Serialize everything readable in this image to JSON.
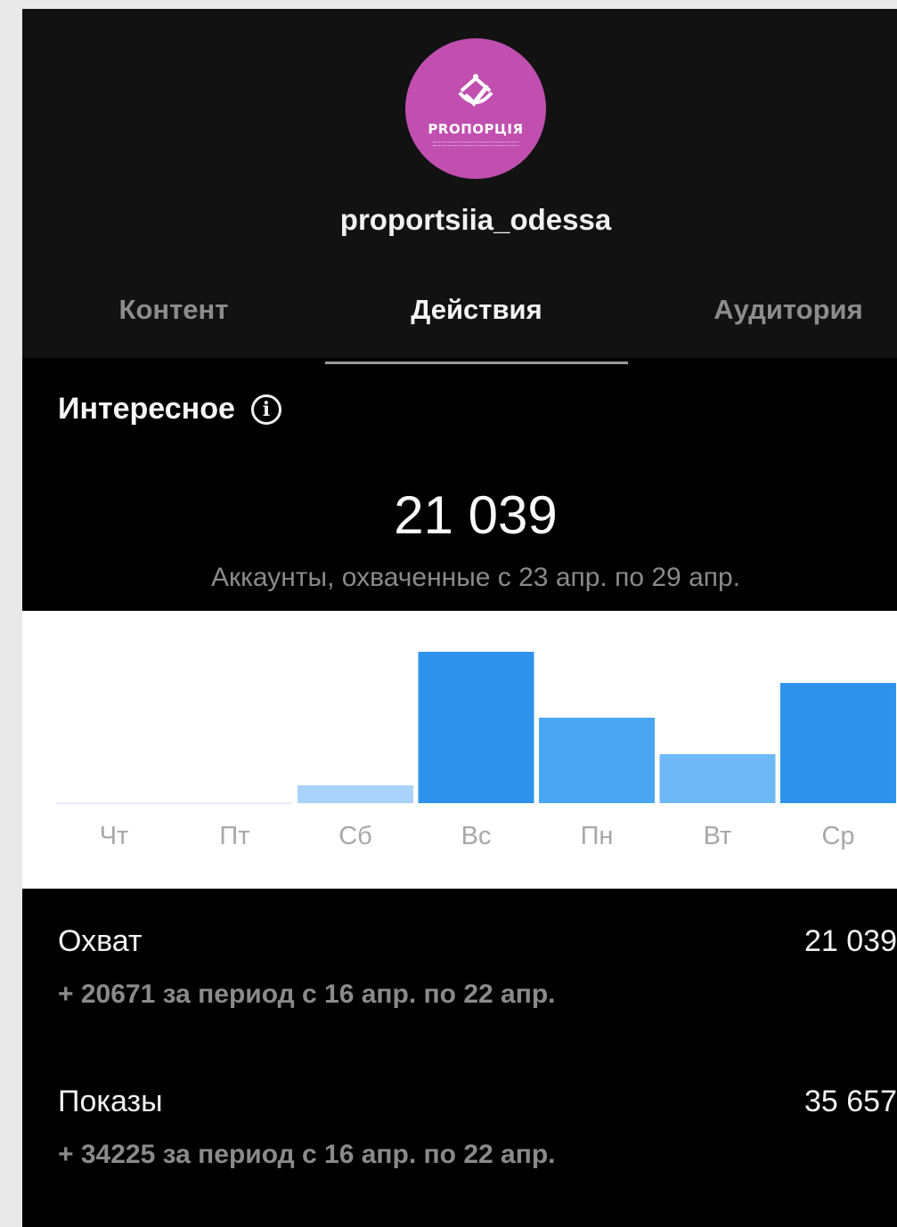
{
  "profile": {
    "username": "proportsiia_odessa",
    "avatar_brand": "PROПOPЦIЯ",
    "avatar_color": "#c04fb0"
  },
  "tabs": [
    {
      "label": "Контент",
      "active": false
    },
    {
      "label": "Действия",
      "active": true
    },
    {
      "label": "Аудитория",
      "active": false
    }
  ],
  "discovery": {
    "title": "Интересное",
    "info_icon": "info-icon",
    "total": "21 039",
    "caption": "Аккаунты, охваченные с 23 апр. по 29 апр."
  },
  "chart_data": {
    "type": "bar",
    "categories": [
      "Чт",
      "Пт",
      "Сб",
      "Вс",
      "Пн",
      "Вт",
      "Ср"
    ],
    "values": [
      0,
      0,
      20,
      170,
      96,
      55,
      135
    ],
    "colors": [
      "#d6e8fb",
      "#d6e8fb",
      "#a9d3fa",
      "#2f93ee",
      "#4aa6f3",
      "#6fb8f6",
      "#2f93ee"
    ],
    "grid": false,
    "legend": "none"
  },
  "metrics": [
    {
      "label": "Охват",
      "value": "21 039",
      "delta": "+ 20671 за период с 16 апр. по 22 апр."
    },
    {
      "label": "Показы",
      "value": "35 657",
      "delta": "+ 34225 за период с 16 апр. по 22 апр."
    }
  ]
}
